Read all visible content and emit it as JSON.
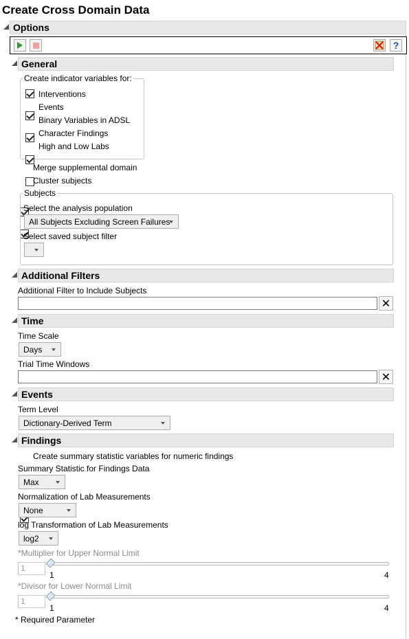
{
  "title": "Create Cross Domain Data",
  "options": {
    "header": "Options",
    "toolbar": {
      "run_icon": "play-icon",
      "stop_icon": "stop-icon",
      "clear_icon": "clear-icon",
      "help_icon": "?"
    }
  },
  "general": {
    "header": "General",
    "indicator_legend": "Create indicator variables for:",
    "indicator_items": [
      {
        "label": "Interventions",
        "checked": true
      },
      {
        "label": "Events",
        "checked": true
      },
      {
        "label": "Binary Variables in ADSL",
        "checked": true
      },
      {
        "label": "Character Findings",
        "checked": true
      },
      {
        "label": "High and Low Labs",
        "checked": false
      }
    ],
    "merge_label": "Merge supplemental domain",
    "cluster_label": "Cluster subjects",
    "subjects": {
      "legend": "Subjects",
      "population_label": "Select the analysis population",
      "population_value": "All Subjects Excluding Screen Failures",
      "filter_label": "Select saved subject filter",
      "filter_value": ""
    }
  },
  "additional_filters": {
    "header": "Additional Filters",
    "include_label": "Additional Filter to Include Subjects",
    "include_value": "",
    "clear_icon": "✕"
  },
  "time": {
    "header": "Time",
    "scale_label": "Time Scale",
    "scale_value": "Days",
    "windows_label": "Trial Time Windows",
    "windows_value": "",
    "clear_icon": "✕"
  },
  "events": {
    "header": "Events",
    "term_level_label": "Term Level",
    "term_level_value": "Dictionary-Derived Term"
  },
  "findings": {
    "header": "Findings",
    "summary_check_label": "Create summary statistic variables for numeric findings",
    "summary_stat_label": "Summary Statistic for Findings Data",
    "summary_stat_value": "Max",
    "normalization_label": "Normalization of Lab Measurements",
    "normalization_value": "None",
    "log_label": "log Transformation of Lab Measurements",
    "log_value": "log2",
    "upper": {
      "label": "*Multiplier for Upper Normal Limit",
      "value": "1",
      "min": "1",
      "max": "4"
    },
    "lower": {
      "label": "*Divisor for Lower Normal Limit",
      "value": "1",
      "min": "1",
      "max": "4"
    }
  },
  "footer": {
    "required_note": "* Required Parameter"
  }
}
